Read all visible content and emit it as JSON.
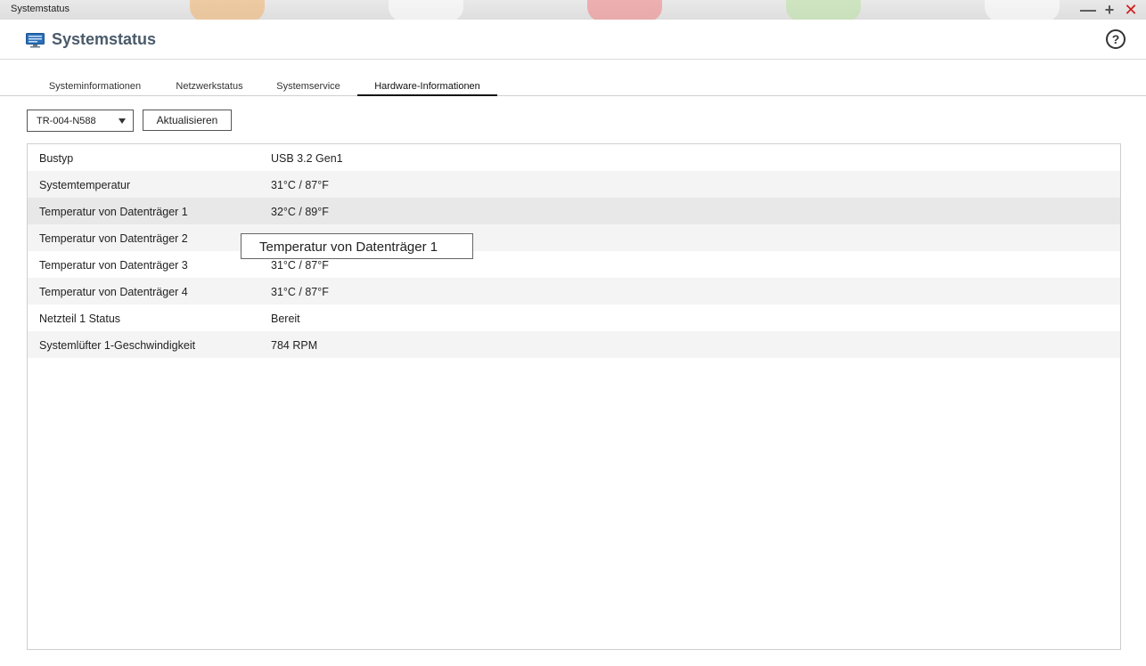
{
  "window": {
    "title": "Systemstatus",
    "controls": {
      "minimize": "—",
      "maximize": "+",
      "close": "✕"
    },
    "close_color": "#d11a1a"
  },
  "header": {
    "title": "Systemstatus",
    "help": "?",
    "icon": "monitor-icon",
    "accent": "#2a6fb8"
  },
  "tabs": [
    {
      "label": "Systeminformationen",
      "active": false
    },
    {
      "label": "Netzwerkstatus",
      "active": false
    },
    {
      "label": "Systemservice",
      "active": false
    },
    {
      "label": "Hardware-Informationen",
      "active": true
    }
  ],
  "toolbar": {
    "device_select": "TR-004-N588",
    "refresh_label": "Aktualisieren"
  },
  "table": {
    "rows": [
      {
        "key": "Bustyp",
        "value": "USB 3.2 Gen1"
      },
      {
        "key": "Systemtemperatur",
        "value": "31°C / 87°F"
      },
      {
        "key": "Temperatur von Datenträger 1",
        "value": "32°C / 89°F"
      },
      {
        "key": "Temperatur von Datenträger 2",
        "value": ""
      },
      {
        "key": "Temperatur von Datenträger 3",
        "value": "31°C / 87°F"
      },
      {
        "key": "Temperatur von Datenträger 4",
        "value": "31°C / 87°F"
      },
      {
        "key": "Netzteil 1 Status",
        "value": "Bereit"
      },
      {
        "key": "Systemlüfter 1-Geschwindigkeit",
        "value": "784 RPM"
      }
    ]
  },
  "tooltip": "Temperatur von Datenträger 1"
}
